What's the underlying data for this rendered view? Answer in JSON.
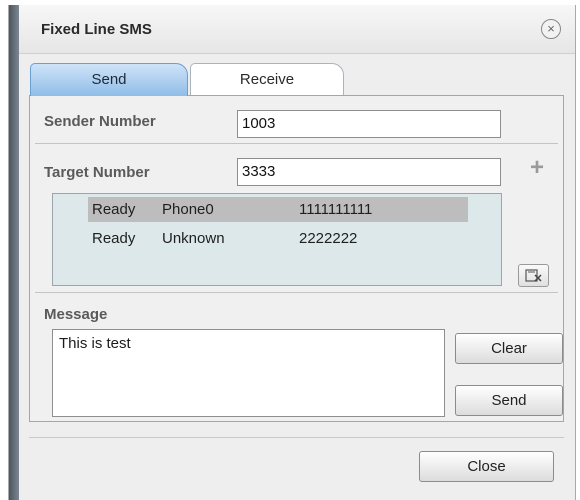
{
  "window": {
    "title": "Fixed Line SMS",
    "close_glyph": "×"
  },
  "tabs": [
    {
      "label": "Send",
      "active": true
    },
    {
      "label": "Receive",
      "active": false
    }
  ],
  "form": {
    "sender_label": "Sender Number",
    "sender_value": "1003",
    "target_label": "Target Number",
    "target_value": "3333",
    "add_glyph": "+",
    "message_label": "Message",
    "message_text": "This is test"
  },
  "targets": [
    {
      "status": "Ready",
      "name": "Phone0",
      "number": "1111111111",
      "selected": true
    },
    {
      "status": "Ready",
      "name": "Unknown",
      "number": "2222222",
      "selected": false
    }
  ],
  "buttons": {
    "clear": "Clear",
    "send": "Send",
    "close": "Close"
  },
  "colors": {
    "active_tab": "#8fbde8",
    "selected_row": "#bdbdbd",
    "list_bg": "#dde8ea"
  }
}
